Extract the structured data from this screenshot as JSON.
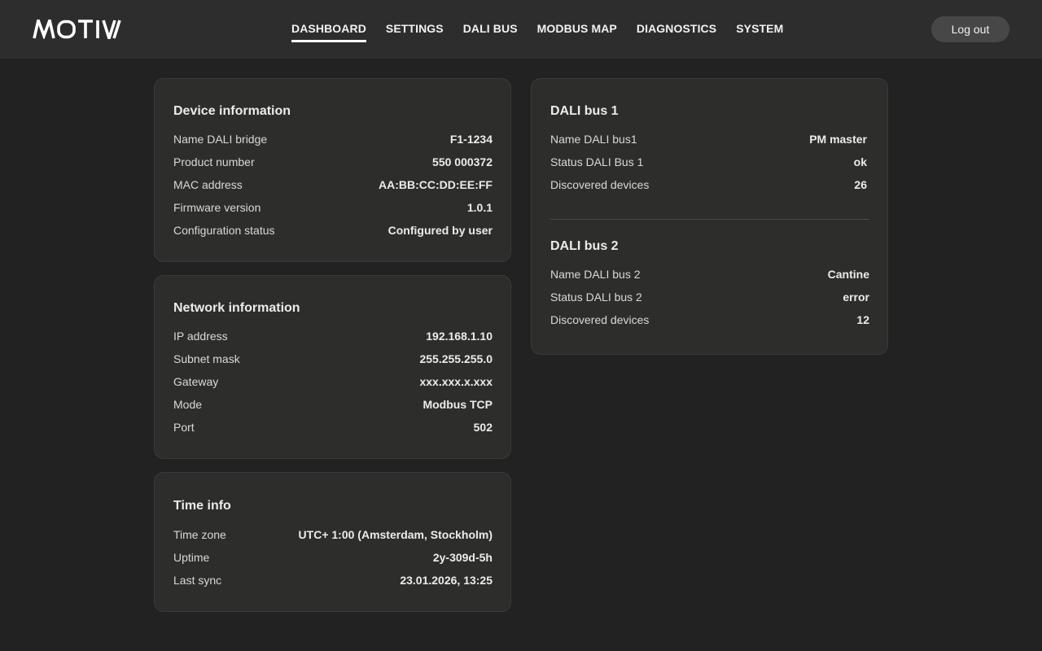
{
  "header": {
    "logo_icon": "motiv-logo",
    "nav": [
      {
        "label": "DASHBOARD",
        "active": true
      },
      {
        "label": "SETTINGS",
        "active": false
      },
      {
        "label": "DALI BUS",
        "active": false
      },
      {
        "label": "MODBUS MAP",
        "active": false
      },
      {
        "label": "DIAGNOSTICS",
        "active": false
      },
      {
        "label": "SYSTEM",
        "active": false
      }
    ],
    "logout_label": "Log out"
  },
  "device_info": {
    "title": "Device information",
    "rows": [
      {
        "label": "Name DALI bridge",
        "value": "F1-1234"
      },
      {
        "label": "Product number",
        "value": "550 000372"
      },
      {
        "label": "MAC address",
        "value": "AA:BB:CC:DD:EE:FF"
      },
      {
        "label": "Firmware version",
        "value": "1.0.1"
      },
      {
        "label": "Configuration status",
        "value": "Configured by user"
      }
    ]
  },
  "network_info": {
    "title": "Network information",
    "rows": [
      {
        "label": "IP address",
        "value": "192.168.1.10"
      },
      {
        "label": "Subnet mask",
        "value": "255.255.255.0"
      },
      {
        "label": "Gateway",
        "value": "xxx.xxx.x.xxx"
      },
      {
        "label": "Mode",
        "value": "Modbus TCP"
      },
      {
        "label": "Port",
        "value": "502"
      }
    ]
  },
  "time_info": {
    "title": "Time info",
    "rows": [
      {
        "label": "Time zone",
        "value": "UTC+ 1:00 (Amsterdam, Stockholm)"
      },
      {
        "label": "Uptime",
        "value": "2y-309d-5h"
      },
      {
        "label": "Last sync",
        "value": "23.01.2026, 13:25"
      }
    ]
  },
  "dali_bus_1": {
    "title": "DALI bus 1",
    "rows": [
      {
        "label": "Name DALI bus1",
        "value": "PM master"
      },
      {
        "label": "Status DALI Bus 1",
        "value": "ok"
      },
      {
        "label": "Discovered devices",
        "value": "26"
      }
    ]
  },
  "dali_bus_2": {
    "title": "DALI bus 2",
    "rows": [
      {
        "label": "Name DALI bus 2",
        "value": "Cantine"
      },
      {
        "label": "Status DALI bus 2",
        "value": "error"
      },
      {
        "label": "Discovered devices",
        "value": "12"
      }
    ]
  },
  "colors": {
    "background": "#222222",
    "header": "#2d2d2d",
    "card": "#2d2d2b",
    "logout_button": "#474747"
  }
}
